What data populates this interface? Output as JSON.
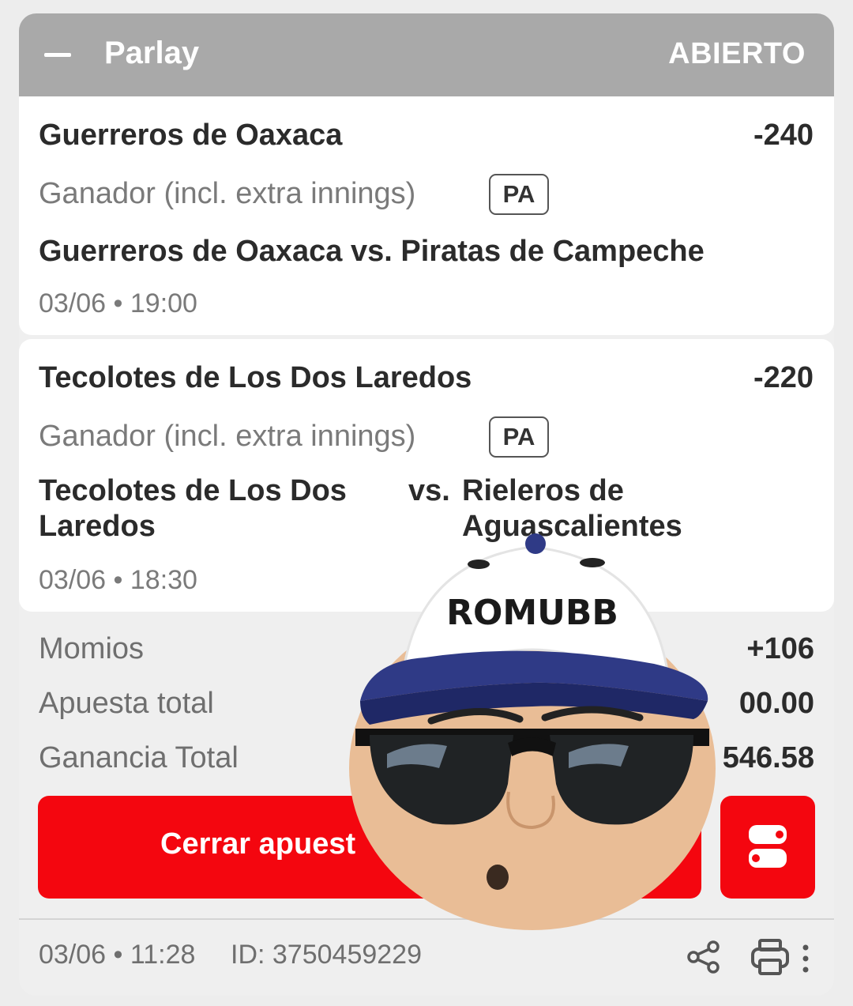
{
  "header": {
    "title": "Parlay",
    "status": "ABIERTO"
  },
  "selections": [
    {
      "team": "Guerreros de Oaxaca",
      "odds": "-240",
      "market": "Ganador (incl. extra innings)",
      "badge": "PA",
      "match": "Guerreros de Oaxaca vs. Piratas de Campeche",
      "datetime": "03/06 • 19:00"
    },
    {
      "team": "Tecolotes de Los Dos Laredos",
      "odds": "-220",
      "market": "Ganador (incl. extra innings)",
      "badge": "PA",
      "match_home_line1": "Tecolotes de Los Dos",
      "match_home_line2": "Laredos",
      "match_vs": "vs.",
      "match_away_line1": "Rieleros de",
      "match_away_line2": "Aguascalientes",
      "datetime": "03/06 • 18:30"
    }
  ],
  "summary": {
    "odds_label": "Momios",
    "odds_value": "+106",
    "stake_label": "Apuesta total",
    "stake_value": "00.00",
    "win_label": "Ganancia Total",
    "win_value": "546.58"
  },
  "actions": {
    "cashout_label": "Cerrar apuest"
  },
  "footer": {
    "datetime": "03/06 • 11:28",
    "bet_id": "ID: 3750459229"
  },
  "overlay": {
    "cap_text": "ROMUBB"
  },
  "colors": {
    "accent": "#f4060f",
    "header_bg": "#a9a9a9"
  }
}
